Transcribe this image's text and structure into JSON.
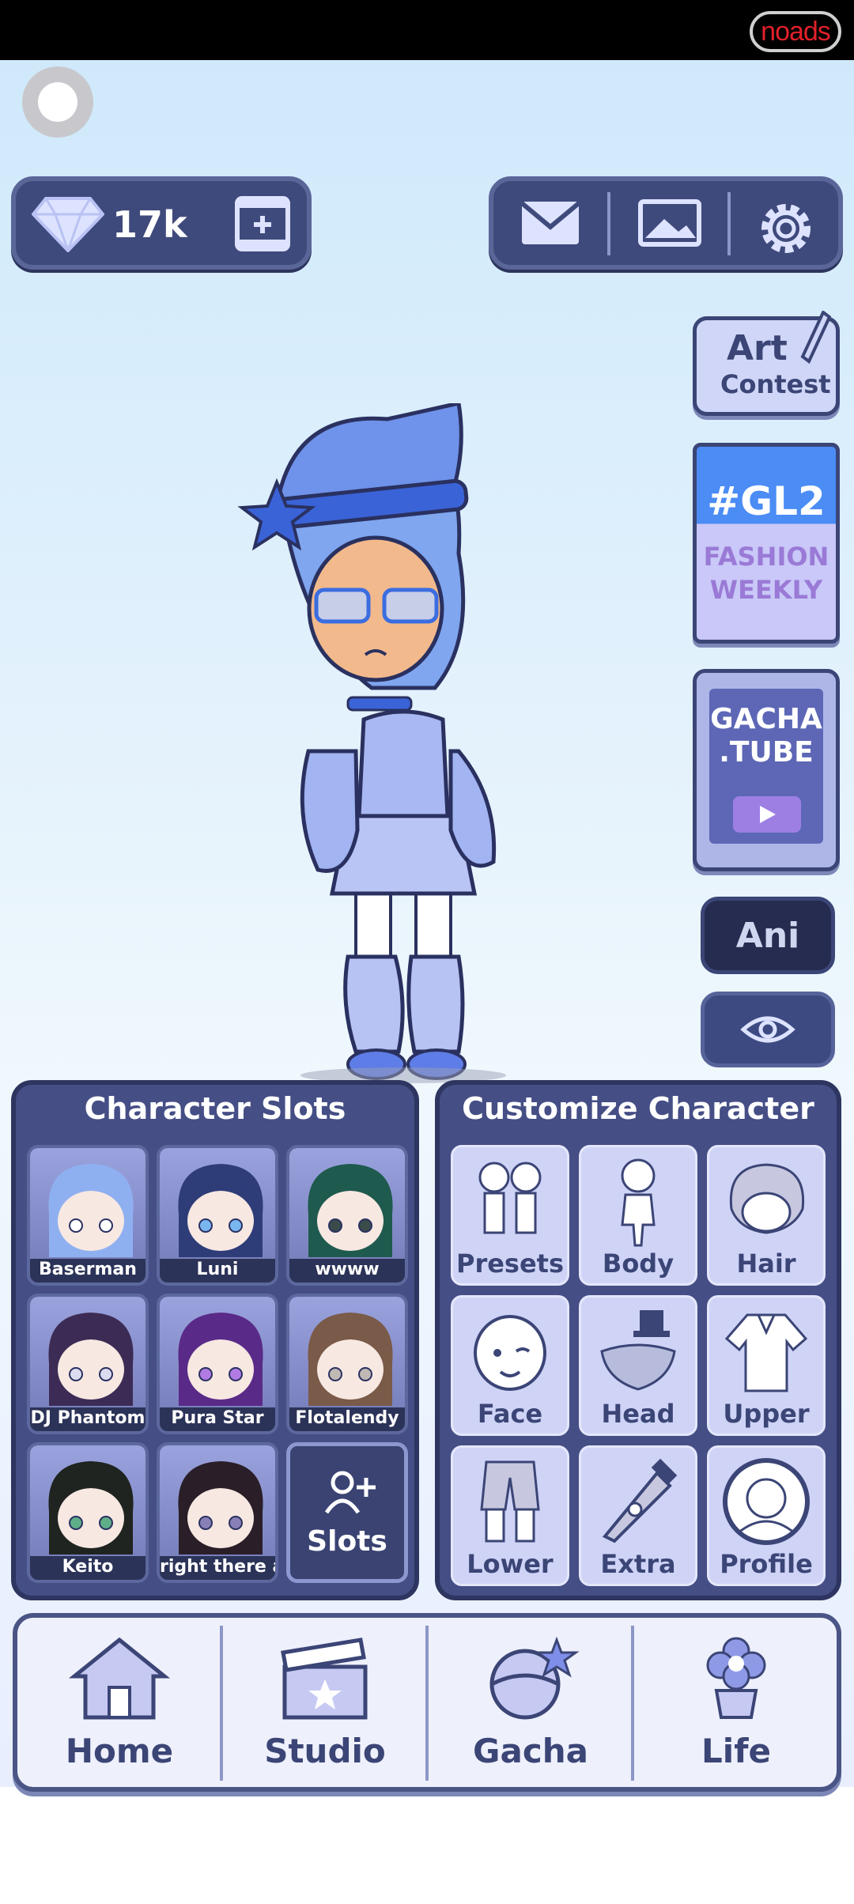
{
  "status_bar": {
    "noads_label": "noads"
  },
  "currency": {
    "gems": "17k"
  },
  "side_buttons": {
    "art_contest": {
      "line1": "Art",
      "line2": "Contest"
    },
    "gl2": {
      "line1": "#GL2",
      "line2": "FASHION",
      "line3": "WEEKLY"
    },
    "gacha_tube": {
      "line1": "GACHA",
      "line2": ".TUBE"
    },
    "ani_label": "Ani"
  },
  "character_slots": {
    "title": "Character Slots",
    "slots": [
      {
        "name": "Baserman",
        "hair": "#8fb0f0",
        "eyes": "#ffffff"
      },
      {
        "name": "Luni",
        "hair": "#2e3d78",
        "eyes": "#7ab6f0"
      },
      {
        "name": "wwww",
        "hair": "#1f5a4e",
        "eyes": "#3a4b4a"
      },
      {
        "name": "DJ Phantom",
        "hair": "#3c2c55",
        "eyes": "#dcdcf0"
      },
      {
        "name": "Pura Star",
        "hair": "#5a2a88",
        "eyes": "#b27be4"
      },
      {
        "name": "Flotalendy",
        "hair": "#7a5a48",
        "eyes": "#c0b8b4"
      },
      {
        "name": "Keito",
        "hair": "#1f2420",
        "eyes": "#5fae8a"
      },
      {
        "name": "right there an",
        "hair": "#2a1f28",
        "eyes": "#8a80b8"
      }
    ],
    "add_label": "Slots"
  },
  "customize": {
    "title": "Customize Character",
    "items": [
      {
        "label": "Presets",
        "icon": "presets-icon"
      },
      {
        "label": "Body",
        "icon": "body-icon"
      },
      {
        "label": "Hair",
        "icon": "hair-icon"
      },
      {
        "label": "Face",
        "icon": "face-icon"
      },
      {
        "label": "Head",
        "icon": "head-icon"
      },
      {
        "label": "Upper",
        "icon": "upper-icon"
      },
      {
        "label": "Lower",
        "icon": "lower-icon"
      },
      {
        "label": "Extra",
        "icon": "extra-icon"
      },
      {
        "label": "Profile",
        "icon": "profile-icon"
      }
    ]
  },
  "nav": [
    {
      "label": "Home",
      "icon": "house-icon"
    },
    {
      "label": "Studio",
      "icon": "clapperboard-icon"
    },
    {
      "label": "Gacha",
      "icon": "gacha-icon"
    },
    {
      "label": "Life",
      "icon": "flower-icon"
    }
  ]
}
